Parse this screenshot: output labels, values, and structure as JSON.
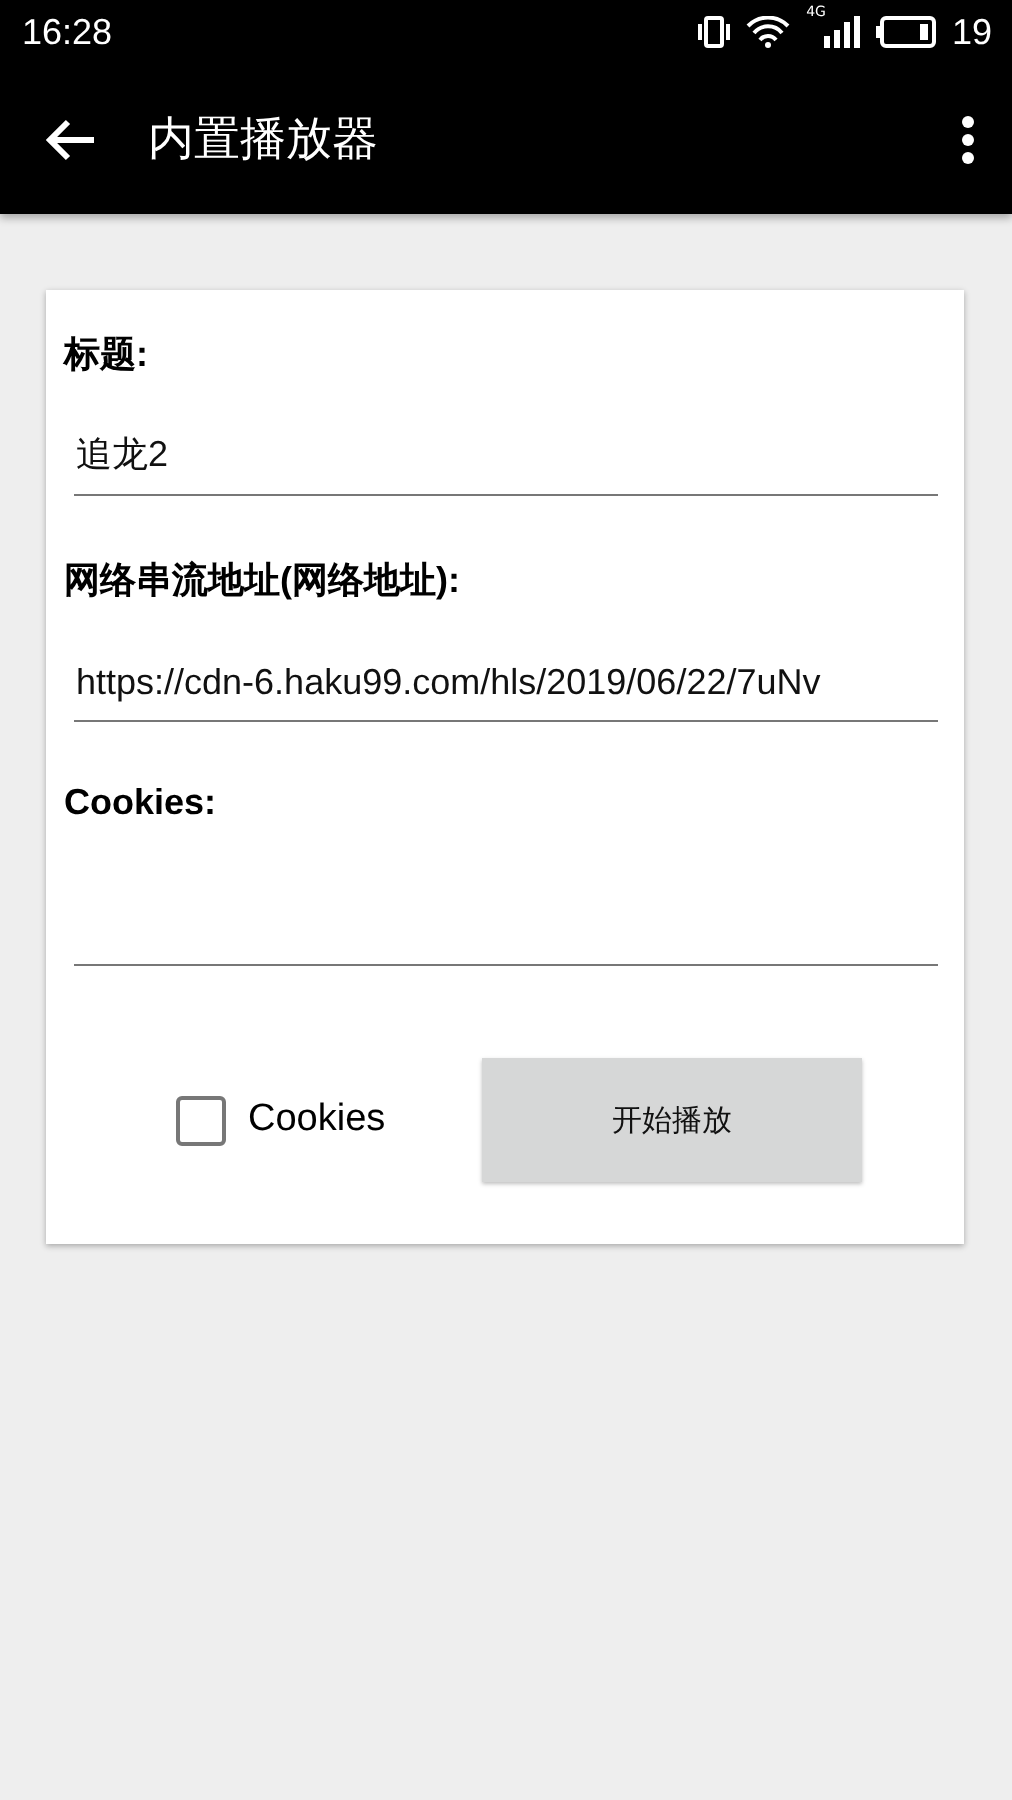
{
  "status_bar": {
    "time": "16:28",
    "battery": "19",
    "network": "4G"
  },
  "app_bar": {
    "title": "内置播放器"
  },
  "form": {
    "fields": [
      {
        "label": "标题:",
        "value": "追龙2"
      },
      {
        "label": "网络串流地址(网络地址):",
        "value": "https://cdn-6.haku99.com/hls/2019/06/22/7uNv"
      },
      {
        "label": "Cookies:"
      }
    ],
    "checkbox": {
      "label": "Cookies",
      "checked": false
    },
    "button": {
      "label": "开始播放"
    }
  }
}
